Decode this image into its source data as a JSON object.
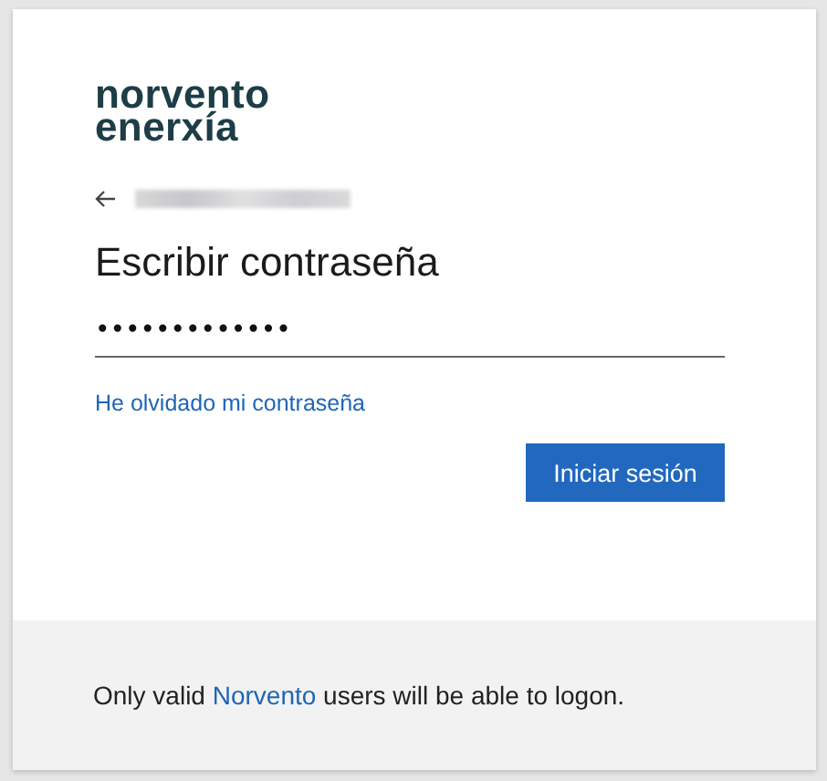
{
  "logo": {
    "line_1": "norvento",
    "line_2": "enerxía"
  },
  "title": "Escribir contraseña",
  "password": {
    "value": "•••••••••••••"
  },
  "forgot_link": "He olvidado mi contraseña",
  "submit_button": "Iniciar sesión",
  "footer": {
    "before": "Only valid ",
    "link": "Norvento",
    "after": " users will be able to logon."
  }
}
